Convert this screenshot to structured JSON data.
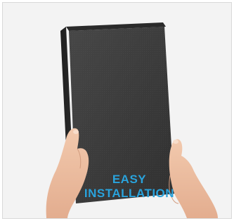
{
  "image": {
    "caption_line1": "EASY",
    "caption_line2": "INSTALLATION",
    "caption_color": "#2aa3dc",
    "panel_color": "#3b3b3b",
    "background_color": "#f3f3f3"
  }
}
